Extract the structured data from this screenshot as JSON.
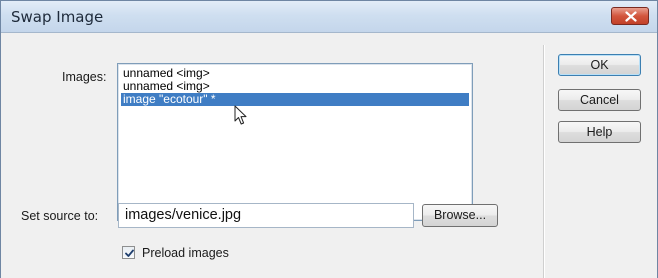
{
  "window": {
    "title": "Swap Image",
    "close_icon": "close-icon"
  },
  "images": {
    "label": "Images:",
    "items": [
      {
        "label": "unnamed <img>",
        "selected": false
      },
      {
        "label": "unnamed <img>",
        "selected": false
      },
      {
        "label": "image \"ecotour\" *",
        "selected": true
      }
    ]
  },
  "source": {
    "label": "Set source to:",
    "value": "images/venice.jpg",
    "browse_label": "Browse..."
  },
  "preload": {
    "label": "Preload images",
    "checked": true
  },
  "buttons": {
    "ok": "OK",
    "cancel": "Cancel",
    "help": "Help"
  },
  "colors": {
    "selection": "#3f7dc4",
    "close_button": "#c24128",
    "title_bar": "#cfdff0"
  },
  "cursor": "arrow-pointer"
}
